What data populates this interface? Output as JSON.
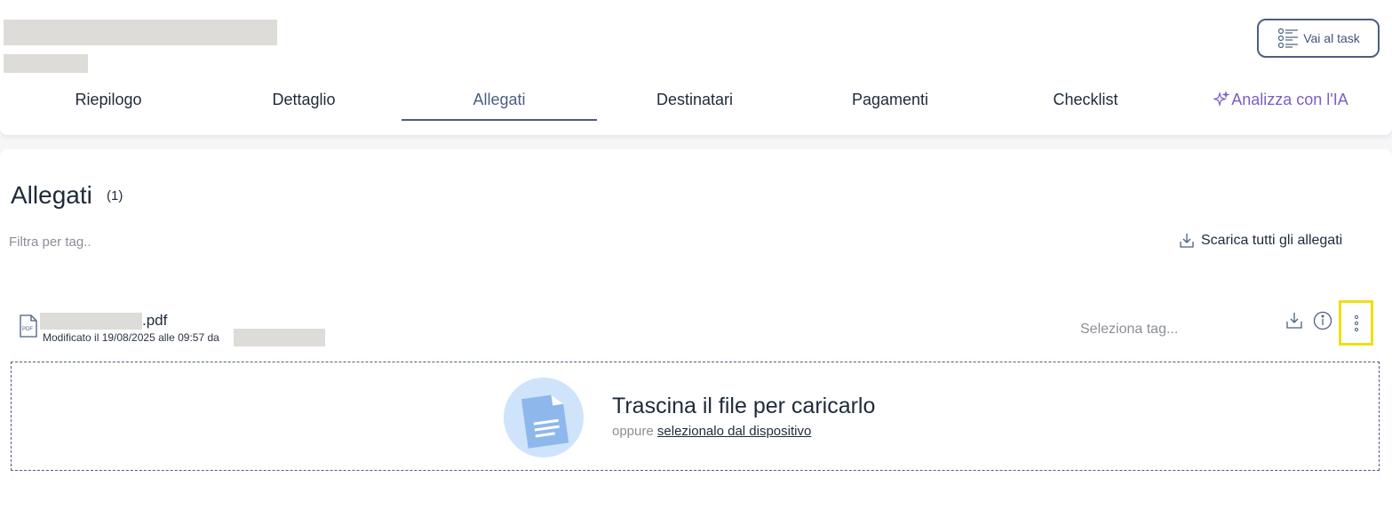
{
  "header": {
    "task_button_label": "Vai al task",
    "tabs": [
      {
        "label": "Riepilogo"
      },
      {
        "label": "Dettaglio"
      },
      {
        "label": "Allegati"
      },
      {
        "label": "Destinatari"
      },
      {
        "label": "Pagamenti"
      },
      {
        "label": "Checklist"
      },
      {
        "label": "Analizza con l'IA"
      }
    ],
    "active_tab": "Allegati"
  },
  "attachments": {
    "title": "Allegati",
    "count": "(1)",
    "filter_placeholder": "Filtra per tag..",
    "download_all_label": "Scarica tutti gli allegati",
    "files": [
      {
        "extension": ".pdf",
        "modified_text": "Modificato il 19/08/2025 alle 09:57 da",
        "tag_placeholder": "Seleziona tag..."
      }
    ],
    "dropzone": {
      "title": "Trascina il file per caricarlo",
      "sub_prefix": "oppure",
      "sub_link": "selezionalo dal dispositivo"
    }
  },
  "colors": {
    "accent": "#4a5f82",
    "ai_purple": "#7b5ec7",
    "highlight": "#f2dd14",
    "text": "#1f2a3a",
    "muted": "#8b8f96"
  },
  "icons": [
    "checklist-icon",
    "sparkle-icon",
    "download-icon",
    "pdf-file-icon",
    "info-icon",
    "kebab-menu-icon",
    "document-upload-icon"
  ]
}
